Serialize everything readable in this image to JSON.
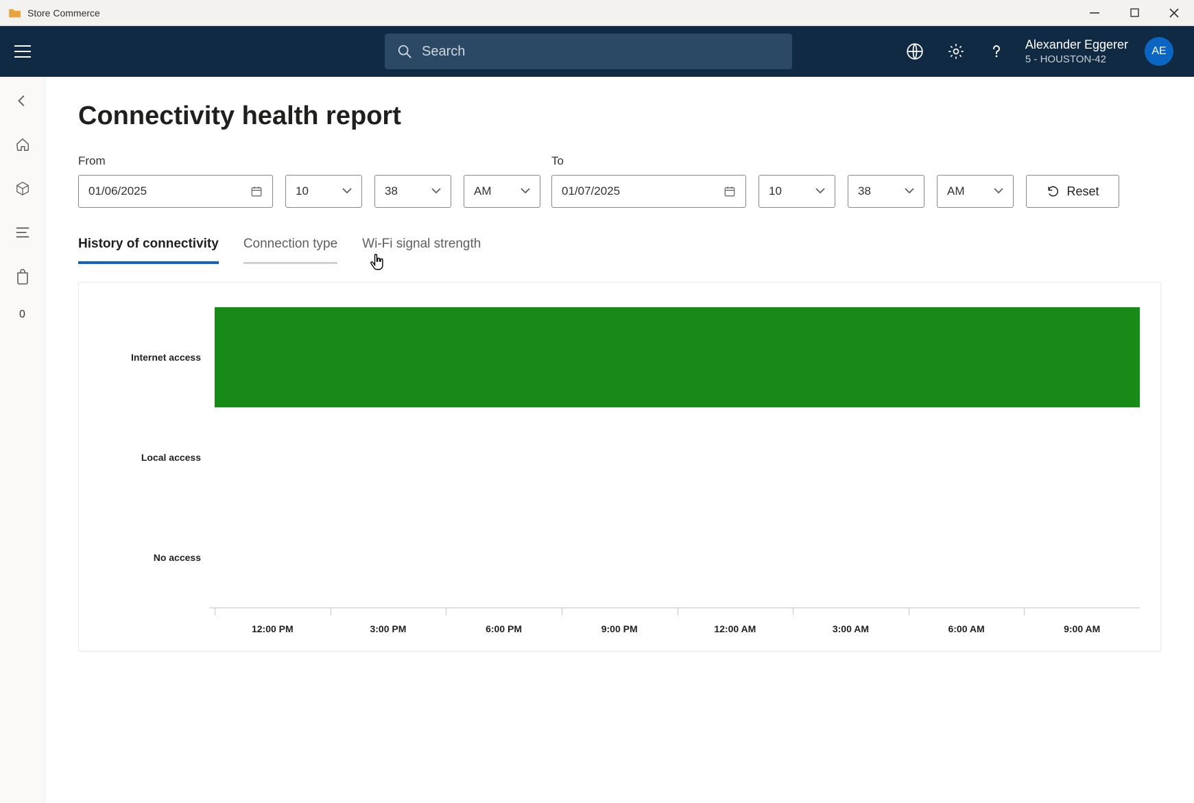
{
  "window": {
    "title": "Store Commerce"
  },
  "topnav": {
    "search_placeholder": "Search",
    "user_name": "Alexander Eggerer",
    "user_sub": "5 - HOUSTON-42",
    "avatar_initials": "AE"
  },
  "leftbar": {
    "badge": "0"
  },
  "page": {
    "title": "Connectivity health report"
  },
  "filters": {
    "from_label": "From",
    "to_label": "To",
    "from_date": "01/06/2025",
    "to_date": "01/07/2025",
    "from_hour": "10",
    "from_min": "38",
    "from_ampm": "AM",
    "to_hour": "10",
    "to_min": "38",
    "to_ampm": "AM",
    "reset_label": "Reset"
  },
  "tabs": {
    "t0": "History of connectivity",
    "t1": "Connection type",
    "t2": "Wi-Fi signal strength"
  },
  "chart_data": {
    "type": "bar",
    "orientation": "horizontal",
    "categories": [
      "Internet access",
      "Local access",
      "No access"
    ],
    "values": [
      100,
      0,
      0
    ],
    "color": "#188a18",
    "xlabel": "",
    "ylabel": "",
    "x_ticks": [
      "12:00 PM",
      "3:00 PM",
      "6:00 PM",
      "9:00 PM",
      "12:00 AM",
      "3:00 AM",
      "6:00 AM",
      "9:00 AM"
    ]
  }
}
